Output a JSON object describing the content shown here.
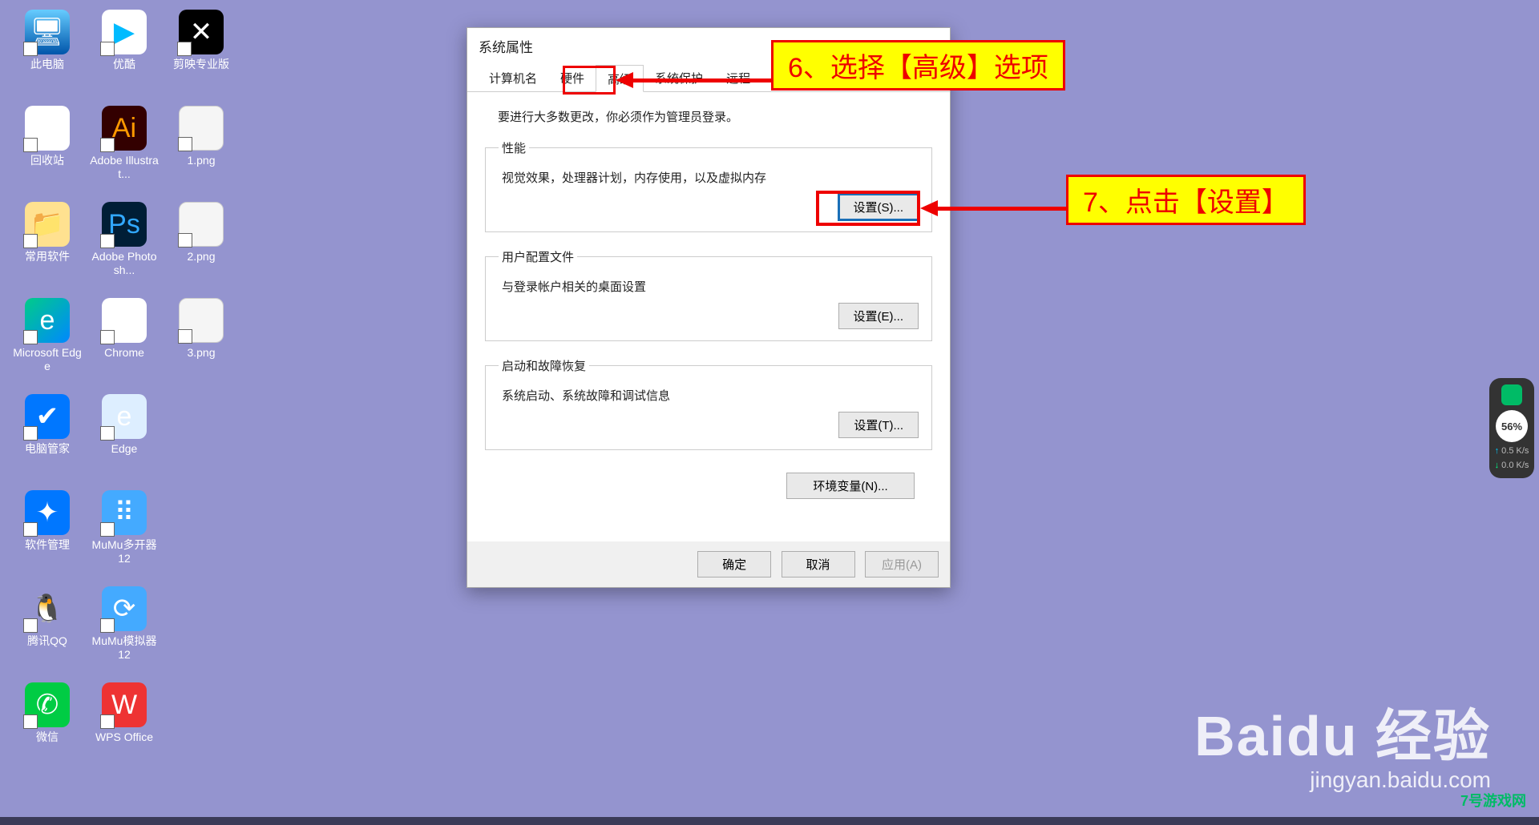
{
  "desktop": {
    "icons": [
      {
        "label": "此电脑",
        "cls": "ic-pc",
        "glyph": "🖥"
      },
      {
        "label": "优酷",
        "cls": "ic-youku",
        "glyph": "▶"
      },
      {
        "label": "剪映专业版",
        "cls": "ic-jianying",
        "glyph": "✕"
      },
      {
        "label": "回收站",
        "cls": "ic-recycle",
        "glyph": "🗑"
      },
      {
        "label": "Adobe Illustrat...",
        "cls": "ic-ai",
        "glyph": "Ai"
      },
      {
        "label": "1.png",
        "cls": "ic-file",
        "glyph": ""
      },
      {
        "label": "常用软件",
        "cls": "ic-folder",
        "glyph": "📁"
      },
      {
        "label": "Adobe Photosh...",
        "cls": "ic-ps",
        "glyph": "Ps"
      },
      {
        "label": "2.png",
        "cls": "ic-file",
        "glyph": ""
      },
      {
        "label": "Microsoft Edge",
        "cls": "ic-edge",
        "glyph": "e"
      },
      {
        "label": "Chrome",
        "cls": "ic-chrome",
        "glyph": "◉"
      },
      {
        "label": "3.png",
        "cls": "ic-file",
        "glyph": ""
      },
      {
        "label": "电脑管家",
        "cls": "ic-tencent",
        "glyph": "✔"
      },
      {
        "label": "Edge",
        "cls": "ic-edge2",
        "glyph": "e"
      },
      {
        "label": "",
        "cls": "",
        "glyph": ""
      },
      {
        "label": "软件管理",
        "cls": "ic-softmgr",
        "glyph": "✦"
      },
      {
        "label": "MuMu多开器12",
        "cls": "ic-mumu",
        "glyph": "⠿"
      },
      {
        "label": "",
        "cls": "",
        "glyph": ""
      },
      {
        "label": "腾讯QQ",
        "cls": "ic-qq",
        "glyph": "🐧"
      },
      {
        "label": "MuMu模拟器12",
        "cls": "ic-mumu2",
        "glyph": "⟳"
      },
      {
        "label": "",
        "cls": "",
        "glyph": ""
      },
      {
        "label": "微信",
        "cls": "ic-wechat",
        "glyph": "✆"
      },
      {
        "label": "WPS Office",
        "cls": "ic-wps",
        "glyph": "W"
      }
    ]
  },
  "dialog": {
    "title": "系统属性",
    "tabs": [
      "计算机名",
      "硬件",
      "高级",
      "系统保护",
      "远程"
    ],
    "active_tab": 2,
    "admin_note": "要进行大多数更改，你必须作为管理员登录。",
    "groups": {
      "perf": {
        "legend": "性能",
        "desc": "视觉效果，处理器计划，内存使用，以及虚拟内存",
        "btn": "设置(S)..."
      },
      "profile": {
        "legend": "用户配置文件",
        "desc": "与登录帐户相关的桌面设置",
        "btn": "设置(E)..."
      },
      "startup": {
        "legend": "启动和故障恢复",
        "desc": "系统启动、系统故障和调试信息",
        "btn": "设置(T)..."
      }
    },
    "env_btn": "环境变量(N)...",
    "footer": {
      "ok": "确定",
      "cancel": "取消",
      "apply": "应用(A)"
    }
  },
  "callouts": {
    "c1": "6、选择【高级】选项",
    "c2": "7、点击【设置】"
  },
  "widget": {
    "pct": "56%",
    "up": "0.5 K/s",
    "dn": "0.0 K/s"
  },
  "brand": {
    "b1": "Baidu 经验",
    "b2": "jingyan.baidu.com"
  },
  "corner": "7号游戏网"
}
